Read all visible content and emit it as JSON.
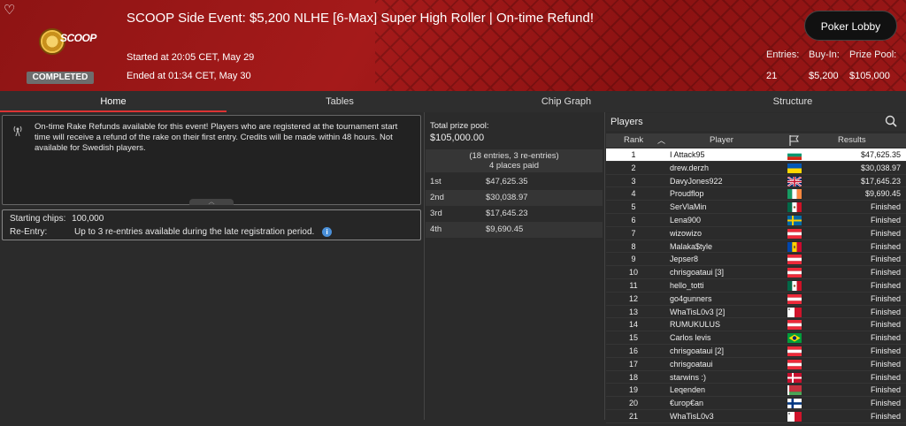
{
  "header": {
    "title": "SCOOP Side Event: $5,200 NLHE [6-Max] Super High Roller | On-time Refund!",
    "started": "Started at 20:05 CET, May 29",
    "ended": "Ended at 01:34 CET, May 30",
    "logo_text": "SCOOP",
    "status_badge": "COMPLETED",
    "lobby_button": "Poker Lobby",
    "stats": [
      {
        "label": "Entries:",
        "value": "21"
      },
      {
        "label": "Buy-In:",
        "value": "$5,200"
      },
      {
        "label": "Prize Pool:",
        "value": "$105,000"
      }
    ]
  },
  "tabs": [
    {
      "label": "Home",
      "active": true
    },
    {
      "label": "Tables",
      "active": false
    },
    {
      "label": "Chip Graph",
      "active": false
    },
    {
      "label": "Structure",
      "active": false
    }
  ],
  "notice": {
    "text": "On-time Rake Refunds available for this event! Players who are registered at the tournament start time will receive a refund of the rake on their first entry. Credits will be made within 48 hours. Not available for Swedish players."
  },
  "chips": {
    "starting_label": "Starting chips:",
    "starting_value": "100,000",
    "reentry_label": "Re-Entry:",
    "reentry_value": "Up to 3 re-entries available during the late registration period."
  },
  "prize": {
    "total_label": "Total prize pool:",
    "total_value": "$105,000.00",
    "entries_line": "(18 entries, 3 re-entries)",
    "places_line": "4 places paid",
    "payouts": [
      {
        "place": "1st",
        "amount": "$47,625.35"
      },
      {
        "place": "2nd",
        "amount": "$30,038.97"
      },
      {
        "place": "3rd",
        "amount": "$17,645.23"
      },
      {
        "place": "4th",
        "amount": "$9,690.45"
      }
    ]
  },
  "players": {
    "title": "Players",
    "columns": {
      "rank": "Rank",
      "player": "Player",
      "results": "Results"
    },
    "rows": [
      {
        "rank": "1",
        "name": "I Attack95",
        "flag": "bulgaria",
        "result": "$47,625.35"
      },
      {
        "rank": "2",
        "name": "drew.derzh",
        "flag": "ukraine",
        "result": "$30,038.97"
      },
      {
        "rank": "3",
        "name": "DavyJones922",
        "flag": "uk",
        "result": "$17,645.23"
      },
      {
        "rank": "4",
        "name": "Proudflop",
        "flag": "ireland",
        "result": "$9,690.45"
      },
      {
        "rank": "5",
        "name": "SerVlaMin",
        "flag": "mexico",
        "result": "Finished"
      },
      {
        "rank": "6",
        "name": "Lena900",
        "flag": "sweden",
        "result": "Finished"
      },
      {
        "rank": "7",
        "name": "wizowizo",
        "flag": "austria",
        "result": "Finished"
      },
      {
        "rank": "8",
        "name": "Malaka$tyle",
        "flag": "moldova",
        "result": "Finished"
      },
      {
        "rank": "9",
        "name": "Jepser8",
        "flag": "austria",
        "result": "Finished"
      },
      {
        "rank": "10",
        "name": "chrisgoataui [3]",
        "flag": "austria",
        "result": "Finished"
      },
      {
        "rank": "11",
        "name": "hello_totti",
        "flag": "mexico",
        "result": "Finished"
      },
      {
        "rank": "12",
        "name": "go4gunners",
        "flag": "austria",
        "result": "Finished"
      },
      {
        "rank": "13",
        "name": "WhaTisL0v3 [2]",
        "flag": "malta",
        "result": "Finished"
      },
      {
        "rank": "14",
        "name": "RUMUKULUS",
        "flag": "austria",
        "result": "Finished"
      },
      {
        "rank": "15",
        "name": "Carlos levis",
        "flag": "brazil",
        "result": "Finished"
      },
      {
        "rank": "16",
        "name": "chrisgoataui [2]",
        "flag": "austria",
        "result": "Finished"
      },
      {
        "rank": "17",
        "name": "chrisgoataui",
        "flag": "austria",
        "result": "Finished"
      },
      {
        "rank": "18",
        "name": "starwins :)",
        "flag": "denmark",
        "result": "Finished"
      },
      {
        "rank": "19",
        "name": "Leqenden",
        "flag": "belarus",
        "result": "Finished"
      },
      {
        "rank": "20",
        "name": "€urop€an",
        "flag": "finland",
        "result": "Finished"
      },
      {
        "rank": "21",
        "name": "WhaTisL0v3",
        "flag": "malta",
        "result": "Finished"
      }
    ]
  }
}
